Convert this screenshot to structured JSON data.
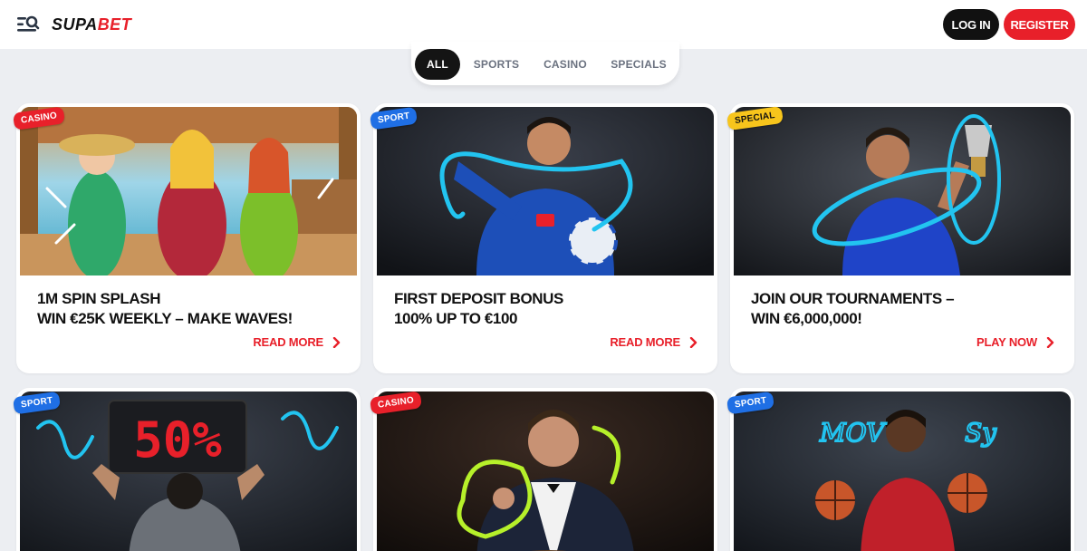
{
  "header": {
    "logo_text_a": "SUPA",
    "logo_text_b": "BET",
    "menu_icon": "menu-search-icon",
    "login_label": "LOG IN",
    "register_label": "REGISTER"
  },
  "filters": {
    "tabs": [
      {
        "label": "ALL",
        "active": true
      },
      {
        "label": "SPORTS",
        "active": false
      },
      {
        "label": "CASINO",
        "active": false
      },
      {
        "label": "SPECIALS",
        "active": false
      }
    ]
  },
  "promos": [
    {
      "badge": "CASINO",
      "title_line1": "1M SPIN SPLASH",
      "title_line2": "WIN €25K WEEKLY – MAKE WAVES!",
      "cta": "READ MORE"
    },
    {
      "badge": "SPORT",
      "title_line1": "FIRST DEPOSIT BONUS",
      "title_line2": "100% UP TO €100",
      "cta": "READ MORE"
    },
    {
      "badge": "SPECIAL",
      "title_line1": "JOIN OUR TOURNAMENTS –",
      "title_line2": "WIN €6,000,000!",
      "cta": "PLAY NOW"
    },
    {
      "badge": "SPORT",
      "image_text": "50%"
    },
    {
      "badge": "CASINO"
    },
    {
      "badge": "SPORT",
      "image_text_a": "MOV",
      "image_text_b": "Sy"
    }
  ],
  "colors": {
    "brand_red": "#e8202a",
    "sport_blue": "#1f6fe5",
    "special_yellow": "#f7c51c",
    "accent_cyan": "#22c4f0",
    "accent_lime": "#b6f02a"
  },
  "icons": {
    "cta_arrow": "chevron-right-icon"
  }
}
